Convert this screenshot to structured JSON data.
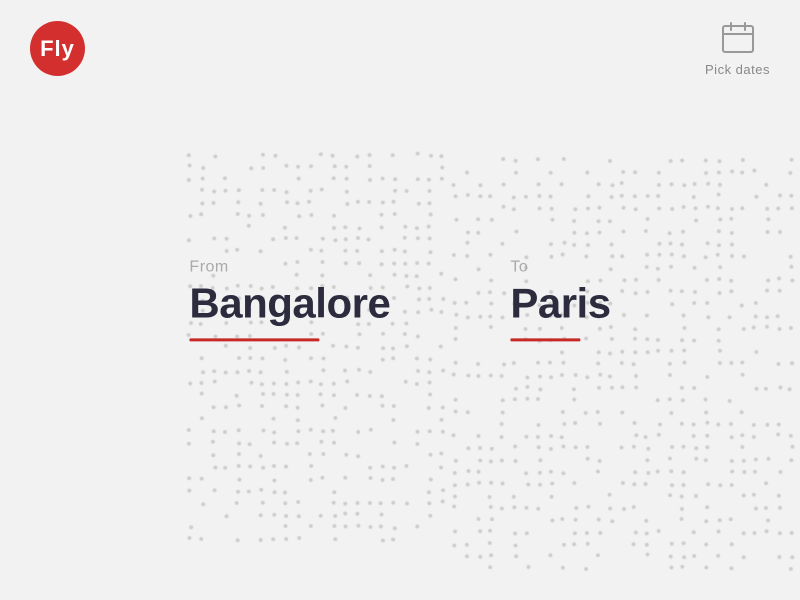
{
  "logo": {
    "text": "Fly",
    "bg_color": "#d32f2f"
  },
  "calendar": {
    "label": "Pick dates"
  },
  "from": {
    "label": "From",
    "city": "Bangalore"
  },
  "to": {
    "label": "To",
    "city": "Paris"
  },
  "colors": {
    "bg": "#f2f2f2",
    "accent": "#c62828",
    "dot": "#cccccc",
    "text_primary": "#2c2c3e",
    "text_muted": "#aaaaaa"
  }
}
